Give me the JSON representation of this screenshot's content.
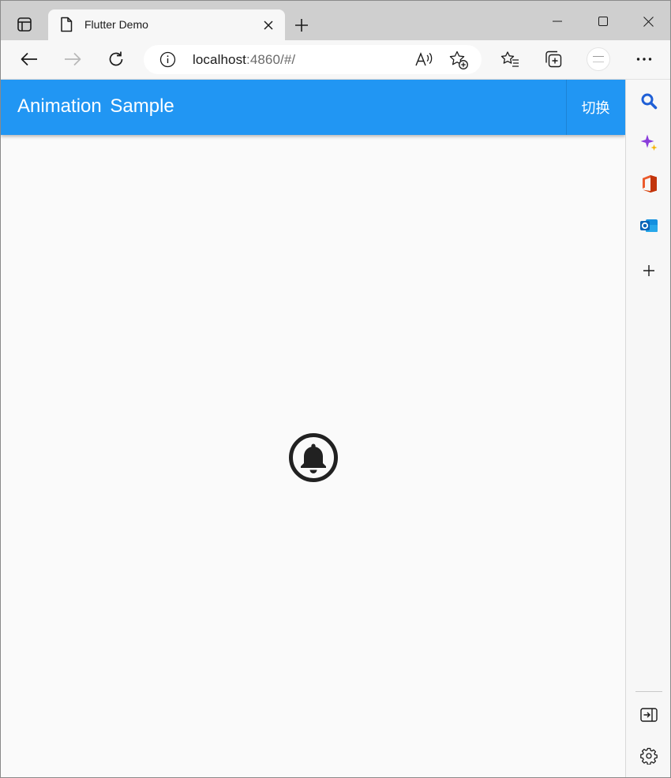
{
  "browser": {
    "tab_title": "Flutter Demo",
    "url_host": "localhost",
    "url_rest": ":4860/#/"
  },
  "app": {
    "title": "Animation  Sample",
    "action_label": "切换"
  },
  "icons": {
    "center": "notifications-bell-icon"
  },
  "colors": {
    "appbar": "#2196f3",
    "page_bg": "#fafafa"
  }
}
